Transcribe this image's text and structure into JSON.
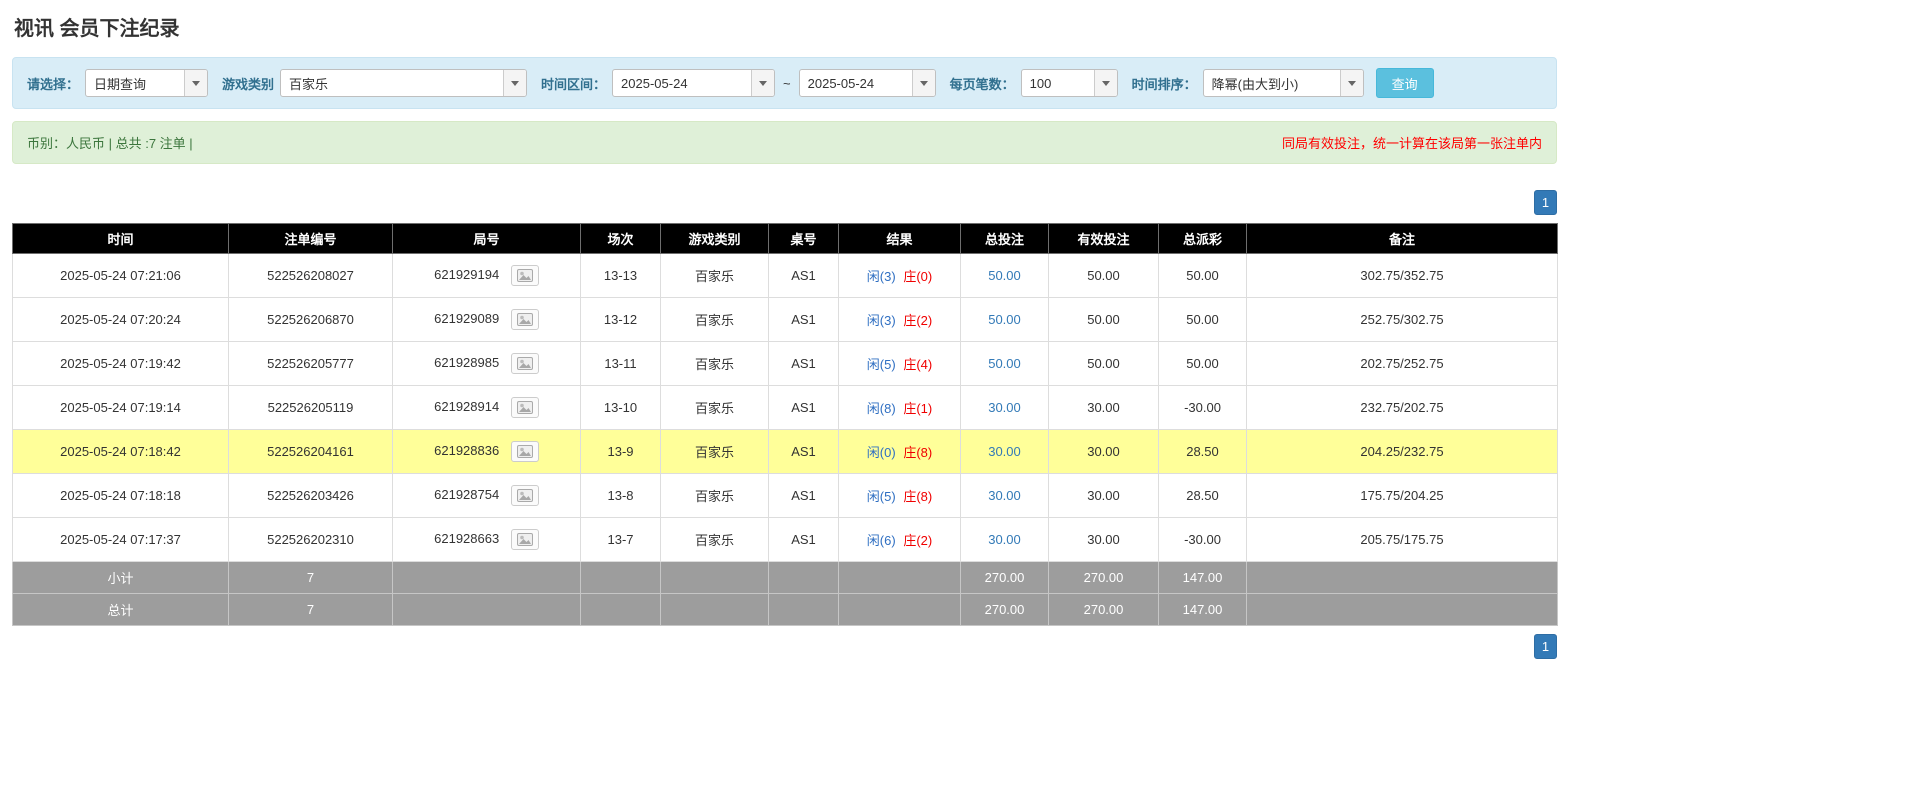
{
  "page": {
    "title": "视讯 会员下注纪录"
  },
  "filters": {
    "select_label": "请选择：",
    "select_value": "日期查询",
    "game_type_label": "游戏类别",
    "game_type_value": "百家乐",
    "time_range_label": "时间区间：",
    "date_from": "2025-05-24",
    "tilde": "~",
    "date_to": "2025-05-24",
    "page_size_label": "每页笔数：",
    "page_size_value": "100",
    "sort_label": "时间排序：",
    "sort_value": "降幂(由大到小)",
    "search_button": "查询"
  },
  "info_bar": {
    "left": "币别：人民币 | 总共 :7 注单 |",
    "right": "同局有效投注，统一计算在该局第一张注单内"
  },
  "pagination": {
    "page": "1"
  },
  "table": {
    "headers": [
      "时间",
      "注单编号",
      "局号",
      "场次",
      "游戏类别",
      "桌号",
      "结果",
      "总投注",
      "有效投注",
      "总派彩",
      "备注"
    ],
    "rows": [
      {
        "time": "2025-05-24 07:21:06",
        "bet_id": "522526208027",
        "round_id": "621929194",
        "session": "13-13",
        "game": "百家乐",
        "table_no": "AS1",
        "result_player": "闲(3)",
        "result_banker": "庄(0)",
        "total_bet": "50.00",
        "valid_bet": "50.00",
        "payout": "50.00",
        "remark": "302.75/352.75",
        "highlight": false
      },
      {
        "time": "2025-05-24 07:20:24",
        "bet_id": "522526206870",
        "round_id": "621929089",
        "session": "13-12",
        "game": "百家乐",
        "table_no": "AS1",
        "result_player": "闲(3)",
        "result_banker": "庄(2)",
        "total_bet": "50.00",
        "valid_bet": "50.00",
        "payout": "50.00",
        "remark": "252.75/302.75",
        "highlight": false
      },
      {
        "time": "2025-05-24 07:19:42",
        "bet_id": "522526205777",
        "round_id": "621928985",
        "session": "13-11",
        "game": "百家乐",
        "table_no": "AS1",
        "result_player": "闲(5)",
        "result_banker": "庄(4)",
        "total_bet": "50.00",
        "valid_bet": "50.00",
        "payout": "50.00",
        "remark": "202.75/252.75",
        "highlight": false
      },
      {
        "time": "2025-05-24 07:19:14",
        "bet_id": "522526205119",
        "round_id": "621928914",
        "session": "13-10",
        "game": "百家乐",
        "table_no": "AS1",
        "result_player": "闲(8)",
        "result_banker": "庄(1)",
        "total_bet": "30.00",
        "valid_bet": "30.00",
        "payout": "-30.00",
        "remark": "232.75/202.75",
        "highlight": false
      },
      {
        "time": "2025-05-24 07:18:42",
        "bet_id": "522526204161",
        "round_id": "621928836",
        "session": "13-9",
        "game": "百家乐",
        "table_no": "AS1",
        "result_player": "闲(0)",
        "result_banker": "庄(8)",
        "total_bet": "30.00",
        "valid_bet": "30.00",
        "payout": "28.50",
        "remark": "204.25/232.75",
        "highlight": true
      },
      {
        "time": "2025-05-24 07:18:18",
        "bet_id": "522526203426",
        "round_id": "621928754",
        "session": "13-8",
        "game": "百家乐",
        "table_no": "AS1",
        "result_player": "闲(5)",
        "result_banker": "庄(8)",
        "total_bet": "30.00",
        "valid_bet": "30.00",
        "payout": "28.50",
        "remark": "175.75/204.25",
        "highlight": false
      },
      {
        "time": "2025-05-24 07:17:37",
        "bet_id": "522526202310",
        "round_id": "621928663",
        "session": "13-7",
        "game": "百家乐",
        "table_no": "AS1",
        "result_player": "闲(6)",
        "result_banker": "庄(2)",
        "total_bet": "30.00",
        "valid_bet": "30.00",
        "payout": "-30.00",
        "remark": "205.75/175.75",
        "highlight": false
      }
    ],
    "subtotal": {
      "label": "小计",
      "count": "7",
      "total_bet": "270.00",
      "valid_bet": "270.00",
      "payout": "147.00"
    },
    "total": {
      "label": "总计",
      "count": "7",
      "total_bet": "270.00",
      "valid_bet": "270.00",
      "payout": "147.00"
    }
  }
}
